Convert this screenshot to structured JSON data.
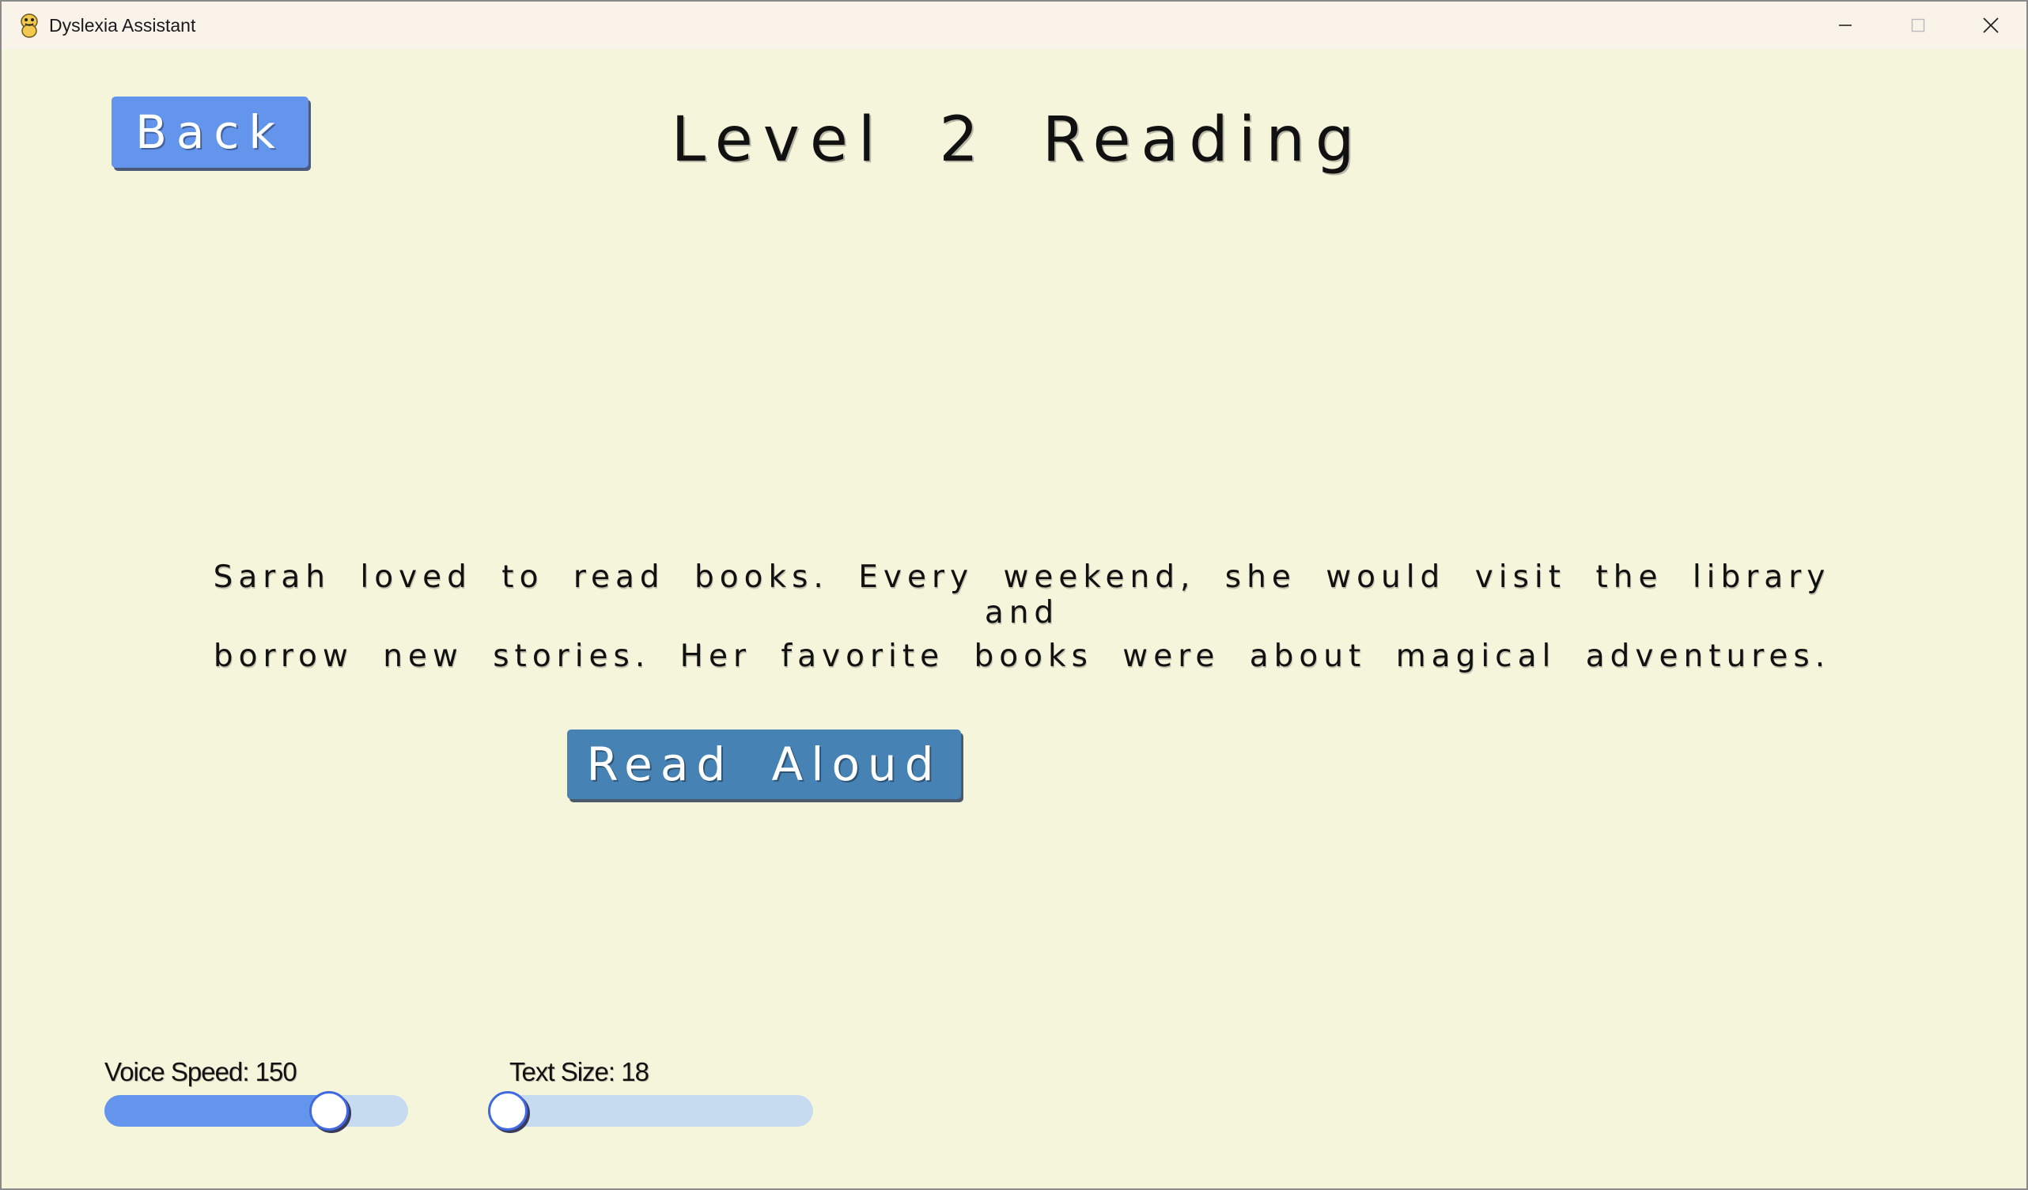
{
  "window": {
    "title": "Dyslexia Assistant",
    "app_icon": "python-snake-icon",
    "controls": [
      "minimize-icon",
      "maximize-icon",
      "close-icon"
    ]
  },
  "header": {
    "back_label": "Back",
    "title": "Level 2 Reading"
  },
  "passage": {
    "line1": "Sarah loved to read books. Every weekend, she would visit the library and",
    "line2": "borrow new stories. Her favorite books were about magical adventures."
  },
  "actions": {
    "read_aloud_label": "Read Aloud"
  },
  "sliders": {
    "voice_speed": {
      "label": "Voice Speed: 150",
      "level": 0.74
    },
    "text_size": {
      "label": "Text Size: 18",
      "level": 0.0
    }
  },
  "colors": {
    "background": "#f5f5dc",
    "back_button": "#6495ed",
    "read_button": "#4682b4",
    "slider_fill": "#6495ed",
    "slider_track": "#c6dbf0"
  }
}
